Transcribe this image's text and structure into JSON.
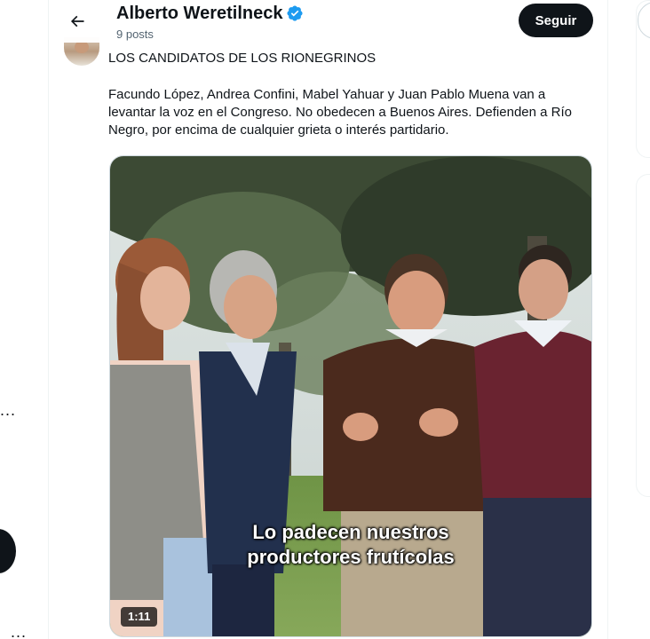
{
  "header": {
    "title": "Alberto Weretilneck",
    "posts_count": "9 posts",
    "follow_label": "Seguir"
  },
  "tweet": {
    "heading": "LOS CANDIDATOS DE LOS RIONEGRINOS",
    "body": "Facundo López, Andrea Confini, Mabel Yahuar y Juan Pablo Muena van a levantar la voz en el Congreso. No obedecen a Buenos Aires. Defienden a Río Negro, por encima de cualquier grieta o interés partidario."
  },
  "video": {
    "caption_line1": "Lo padecen nuestros",
    "caption_line2": "productores frutícolas",
    "duration": "1:11"
  },
  "left_nav": {
    "more_dots": "...",
    "more_dots_bottom": "..."
  },
  "icons": {
    "back": "arrow-left-icon",
    "verified": "verified-badge-icon"
  },
  "colors": {
    "accent": "#1d9bf0",
    "text": "#0f1419",
    "muted": "#536471",
    "button_bg": "#0f1419"
  }
}
